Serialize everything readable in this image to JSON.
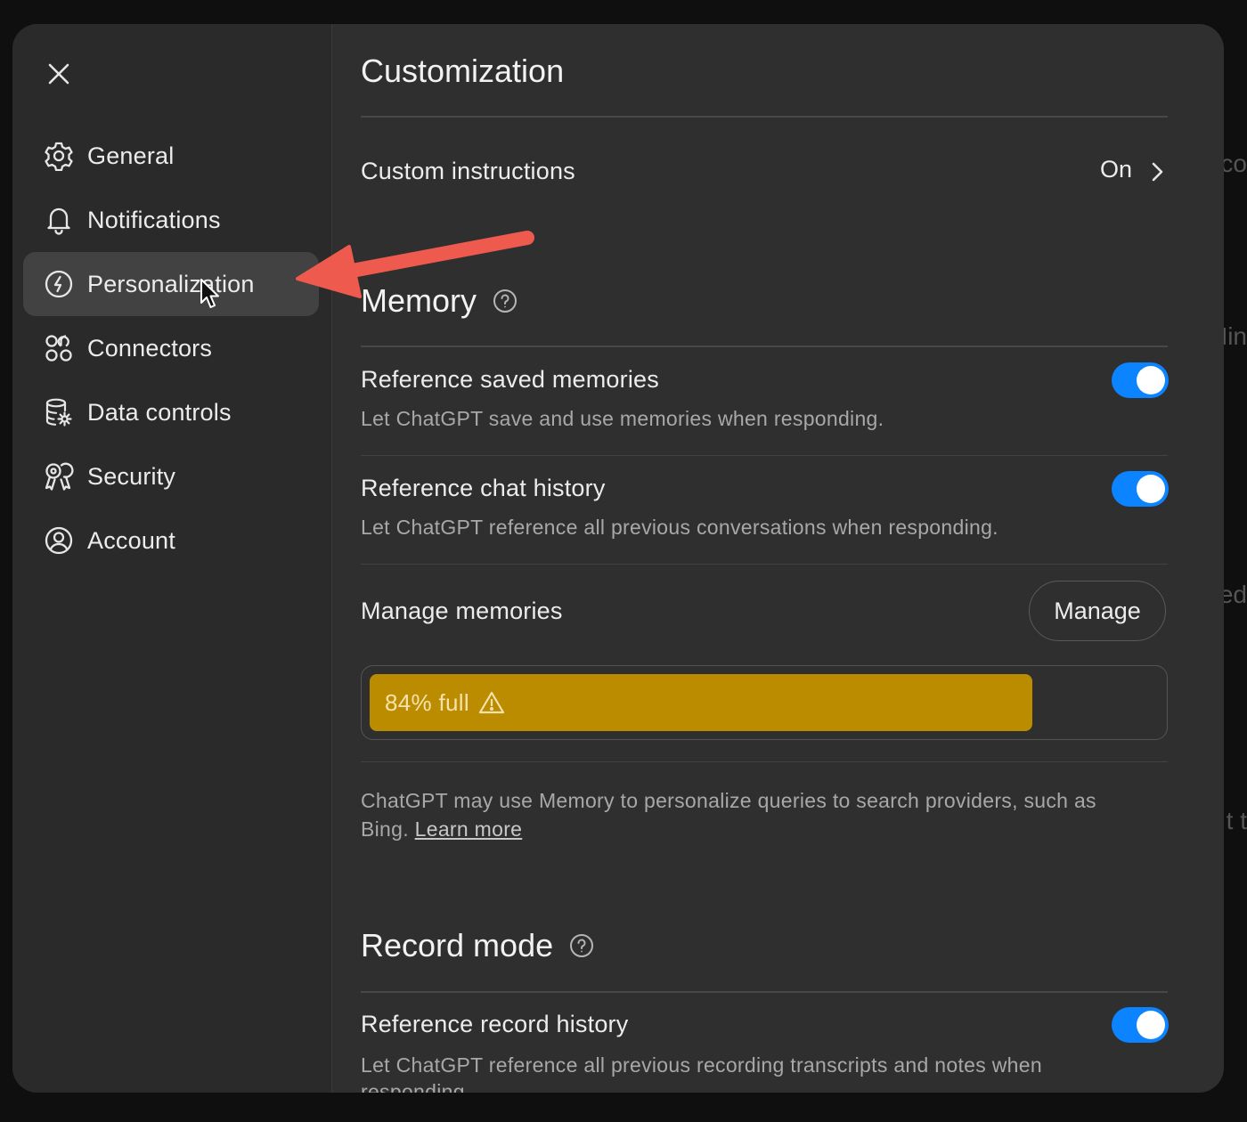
{
  "background_peek": [
    "co",
    "Min",
    "ed",
    "t t"
  ],
  "sidebar": {
    "close_icon": "close-icon",
    "items": [
      {
        "label": "General",
        "icon": "gear-icon"
      },
      {
        "label": "Notifications",
        "icon": "bell-icon"
      },
      {
        "label": "Personalization",
        "icon": "personalization-icon",
        "active": true
      },
      {
        "label": "Connectors",
        "icon": "connectors-icon"
      },
      {
        "label": "Data controls",
        "icon": "database-gear-icon"
      },
      {
        "label": "Security",
        "icon": "security-icon"
      },
      {
        "label": "Account",
        "icon": "account-icon"
      }
    ]
  },
  "main": {
    "title": "Customization",
    "custom_instructions": {
      "label": "Custom instructions",
      "value": "On"
    },
    "memory": {
      "title": "Memory",
      "reference_saved": {
        "label": "Reference saved memories",
        "description": "Let ChatGPT save and use memories when responding.",
        "enabled": true
      },
      "reference_chat": {
        "label": "Reference chat history",
        "description": "Let ChatGPT reference all previous conversations when responding.",
        "enabled": true
      },
      "manage": {
        "label": "Manage memories",
        "button": "Manage"
      },
      "usage": {
        "text": "84% full",
        "percent": 84,
        "color": "#bc8c00"
      },
      "info": "ChatGPT may use Memory to personalize queries to search providers, such as Bing.",
      "learn_more": "Learn more"
    },
    "record_mode": {
      "title": "Record mode",
      "reference_record": {
        "label": "Reference record history",
        "description": "Let ChatGPT reference all previous recording transcripts and notes when responding.",
        "enabled": true
      }
    }
  },
  "colors": {
    "toggle_on": "#0d84ff",
    "annotation_arrow": "#ef5a4f",
    "modal_bg": "#2f2f2f",
    "sidebar_active": "#424242"
  }
}
